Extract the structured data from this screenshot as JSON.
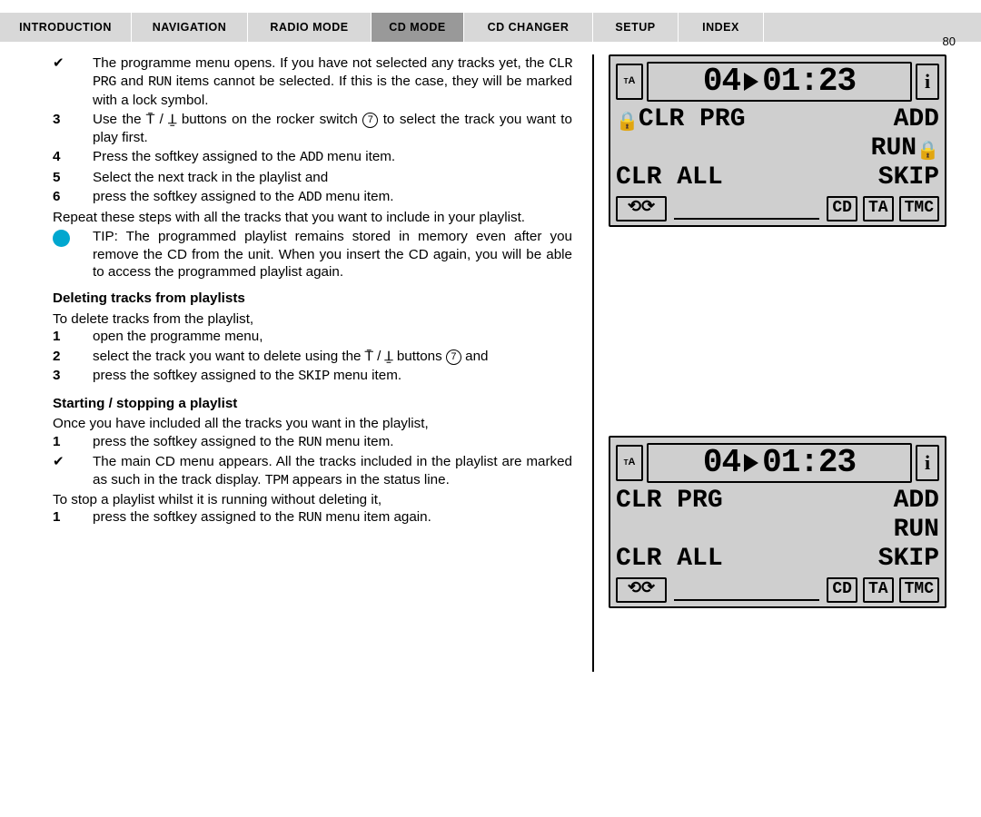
{
  "pageNumber": "80",
  "tabs": [
    "Introduction",
    "Navigation",
    "Radio Mode",
    "Cd Mode",
    "Cd Changer",
    "Setup",
    "Index"
  ],
  "activeTab": 3,
  "body": {
    "p1": "The programme menu opens. If you have not selected any tracks yet, the ",
    "p1b": " and ",
    "p1c": " items cannot be selected. If this is the case, they will be marked with a lock symbol.",
    "clr": "CLR PRG",
    "run": "RUN",
    "s3a": "Use the ",
    "s3b": " buttons on the rocker switch ",
    "s3c": " to select the track you want to play first.",
    "seven": "7",
    "s4a": "Press the softkey assigned to the ",
    "s4b": " menu item.",
    "add": "ADD",
    "s5": "Select the next track in the playlist and",
    "s6a": "press the softkey assigned to the ",
    "s6b": " menu item.",
    "repeat": "Repeat these steps with all the tracks that you want to include in your playlist.",
    "tip": "TIP: The programmed playlist remains stored in memory even after you remove the CD from the unit. When you insert the CD again, you will be able to access the programmed playlist again.",
    "h1": "Deleting tracks from playlists",
    "d0": "To delete tracks from the playlist,",
    "d1": "open the programme menu,",
    "d2a": "select the track you want to delete using the ",
    "d2b": " buttons ",
    "d2c": " and",
    "d3a": "press the softkey assigned to the ",
    "skip": "SKIP",
    "d3b": " menu item.",
    "h2": "Starting / stopping a playlist",
    "st0": "Once you have included all the tracks you want in the playlist,",
    "st1a": "press the softkey assigned to the ",
    "st1b": " menu item.",
    "st_res_a": "The main CD menu appears. All the tracks included in the playlist are marked as such in the track display. ",
    "tpm": "TPM",
    "st_res_b": " appears in the status line.",
    "stop0": "To stop a playlist whilst it is running without deleting it,",
    "stop1a": "press the softkey assigned to the ",
    "stop1b": " menu item again."
  },
  "display": {
    "ta": "TA",
    "track": "04",
    "time": "01:23",
    "i": "i",
    "row1l": "CLR PRG",
    "row1r": "ADD",
    "row2r": "RUN",
    "row3l": "CLR ALL",
    "row3r": "SKIP",
    "cd": "CD",
    "tab": "TA",
    "tmc": "TMC"
  }
}
